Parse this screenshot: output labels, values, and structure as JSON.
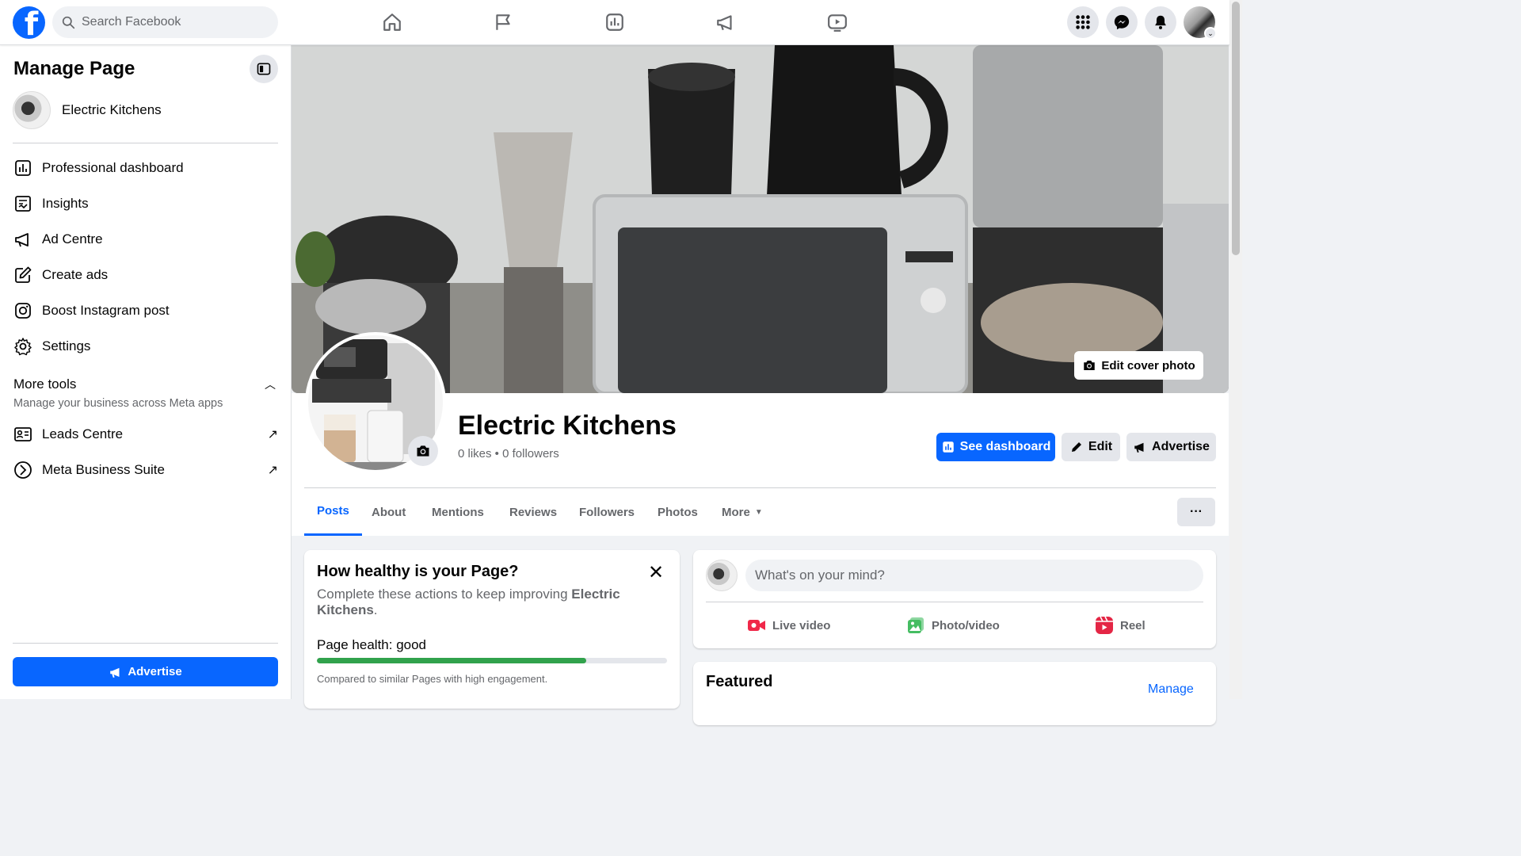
{
  "topbar": {
    "search_placeholder": "Search Facebook",
    "nav": [
      "home-icon",
      "flag-icon",
      "insights-icon",
      "megaphone-icon",
      "video-icon"
    ],
    "right": [
      "menu-grid-icon",
      "messenger-icon",
      "bell-icon",
      "account-avatar"
    ]
  },
  "sidebar": {
    "title": "Manage Page",
    "page_name": "Electric Kitchens",
    "items": [
      {
        "label": "Professional dashboard",
        "icon": "dashboard-icon"
      },
      {
        "label": "Insights",
        "icon": "insights-icon"
      },
      {
        "label": "Ad Centre",
        "icon": "megaphone-icon"
      },
      {
        "label": "Create ads",
        "icon": "pencil-square-icon"
      },
      {
        "label": "Boost Instagram post",
        "icon": "instagram-icon"
      },
      {
        "label": "Settings",
        "icon": "gear-icon"
      }
    ],
    "more_tools": {
      "title": "More tools",
      "subtitle": "Manage your business across Meta apps",
      "items": [
        {
          "label": "Leads Centre",
          "icon": "id-card-icon"
        },
        {
          "label": "Meta Business Suite",
          "icon": "business-suite-icon"
        }
      ]
    },
    "advertise_label": "Advertise"
  },
  "cover": {
    "edit_cover_label": "Edit cover photo"
  },
  "profile": {
    "name": "Electric Kitchens",
    "stats": "0 likes • 0 followers",
    "see_dashboard_label": "See dashboard",
    "edit_label": "Edit",
    "advertise_label": "Advertise"
  },
  "tabs": [
    {
      "label": "Posts",
      "active": true
    },
    {
      "label": "About"
    },
    {
      "label": "Mentions"
    },
    {
      "label": "Reviews"
    },
    {
      "label": "Followers"
    },
    {
      "label": "Photos"
    },
    {
      "label": "More"
    }
  ],
  "tabs_more_button": "···",
  "health_card": {
    "title": "How healthy is your Page?",
    "desc_prefix": "Complete these actions to keep improving ",
    "desc_bold": "Electric Kitchens",
    "desc_suffix": ".",
    "label": "Page health: good",
    "progress": 0.77,
    "note": "Compared to similar Pages with high engagement."
  },
  "composer": {
    "placeholder": "What's on your mind?",
    "actions": [
      {
        "label": "Live video",
        "color": "#f02849"
      },
      {
        "label": "Photo/video",
        "color": "#45bd62"
      },
      {
        "label": "Reel",
        "color": "#e42645"
      }
    ]
  },
  "featured": {
    "title": "Featured",
    "manage_label": "Manage"
  },
  "colors": {
    "accent": "#0866ff",
    "health_good": "#31a24c"
  }
}
